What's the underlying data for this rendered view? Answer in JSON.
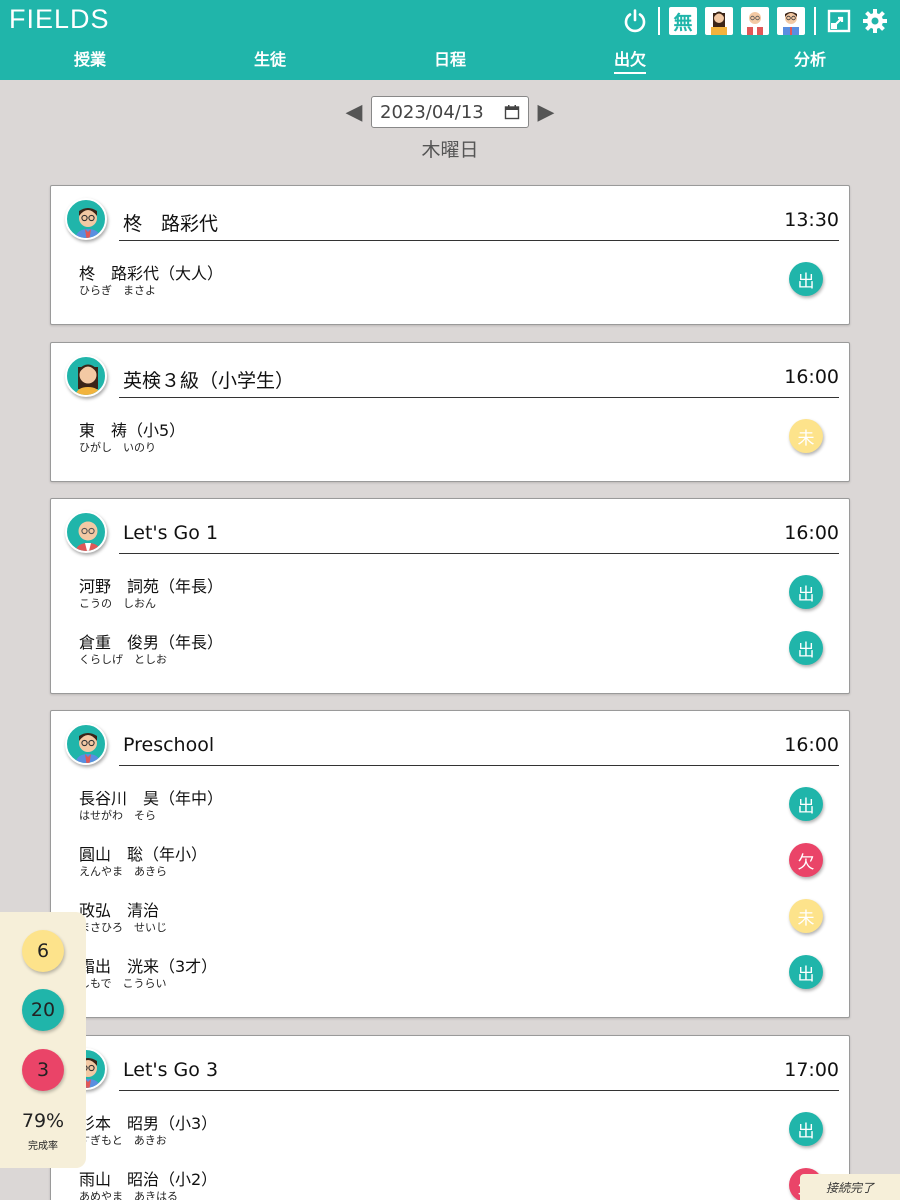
{
  "app": {
    "title": "FIELDS"
  },
  "header_icons": {
    "power": "power-icon",
    "mu_label": "無",
    "teachers": [
      "teacher-female-avatar",
      "teacher-elder-avatar",
      "teacher-male-avatar"
    ],
    "resize": "resize-icon",
    "settings": "gear-icon"
  },
  "nav": {
    "tabs": [
      {
        "label": "授業",
        "active": false
      },
      {
        "label": "生徒",
        "active": false
      },
      {
        "label": "日程",
        "active": false
      },
      {
        "label": "出欠",
        "active": true
      },
      {
        "label": "分析",
        "active": false
      }
    ]
  },
  "date": {
    "value": "2023/04/13",
    "weekday": "木曜日"
  },
  "colors": {
    "accent": "#20b5aa",
    "present": "#20b5aa",
    "absent": "#ea4468",
    "pending": "#fde38b",
    "background": "#dbd7d6"
  },
  "classes": [
    {
      "title": "柊　路彩代",
      "time": "13:30",
      "teacher": "male",
      "students": [
        {
          "name": "柊　路彩代（大人）",
          "kana": "ひらぎ　まさよ",
          "status": "出"
        }
      ]
    },
    {
      "title": "英検３級（小学生）",
      "time": "16:00",
      "teacher": "female",
      "students": [
        {
          "name": "東　祷（小5）",
          "kana": "ひがし　いのり",
          "status": "未"
        }
      ]
    },
    {
      "title": "Let's Go 1",
      "time": "16:00",
      "teacher": "elder",
      "students": [
        {
          "name": "河野　詞苑（年長）",
          "kana": "こうの　しおん",
          "status": "出"
        },
        {
          "name": "倉重　俊男（年長）",
          "kana": "くらしげ　としお",
          "status": "出"
        }
      ]
    },
    {
      "title": "Preschool",
      "time": "16:00",
      "teacher": "male",
      "students": [
        {
          "name": "長谷川　昊（年中）",
          "kana": "はせがわ　そら",
          "status": "出"
        },
        {
          "name": "圓山　聡（年小）",
          "kana": "えんやま　あきら",
          "status": "欠"
        },
        {
          "name": "政弘　清治",
          "kana": "まさひろ　せいじ",
          "status": "未"
        },
        {
          "name": "霜出　洸来（3才）",
          "kana": "しもで　こうらい",
          "status": "出"
        }
      ]
    },
    {
      "title": "Let's Go 3",
      "time": "17:00",
      "teacher": "male",
      "students": [
        {
          "name": "杉本　昭男（小3）",
          "kana": "すぎもと　あきお",
          "status": "出"
        },
        {
          "name": "雨山　昭治（小2）",
          "kana": "あめやま　あきはる",
          "status": "欠"
        }
      ]
    }
  ],
  "stats": {
    "pending": "6",
    "present": "20",
    "absent": "3",
    "rate": "79%",
    "rate_label": "完成率"
  },
  "connection": {
    "status": "接続完了"
  }
}
